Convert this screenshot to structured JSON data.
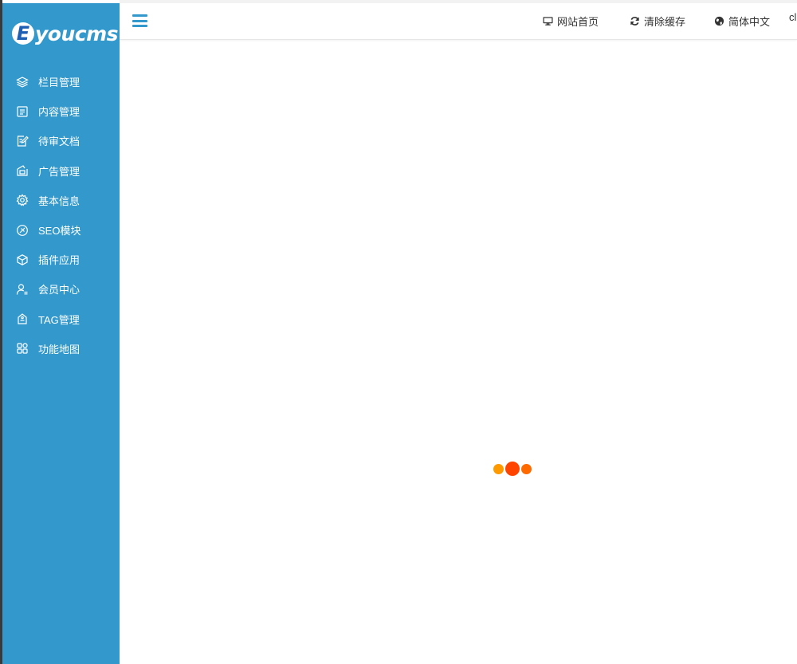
{
  "brand": {
    "logo_letter": "E",
    "logo_text": "youcms"
  },
  "sidebar": {
    "items": [
      {
        "label": "栏目管理",
        "icon": "layers-icon"
      },
      {
        "label": "内容管理",
        "icon": "document-icon"
      },
      {
        "label": "待审文档",
        "icon": "edit-document-icon"
      },
      {
        "label": "广告管理",
        "icon": "ad-icon"
      },
      {
        "label": "基本信息",
        "icon": "gear-icon"
      },
      {
        "label": "SEO模块",
        "icon": "seo-icon"
      },
      {
        "label": "插件应用",
        "icon": "cube-icon"
      },
      {
        "label": "会员中心",
        "icon": "user-icon"
      },
      {
        "label": "TAG管理",
        "icon": "tag-icon"
      },
      {
        "label": "功能地图",
        "icon": "grid-icon"
      }
    ]
  },
  "header": {
    "links": [
      {
        "label": "网站首页",
        "icon": "monitor-icon"
      },
      {
        "label": "清除缓存",
        "icon": "refresh-icon"
      },
      {
        "label": "简体中文",
        "icon": "globe-icon"
      }
    ],
    "user_text": "cl"
  },
  "colors": {
    "sidebar": "#3399cc",
    "loader_dots": [
      "#ff9900",
      "#ff4400",
      "#ff6a00"
    ]
  }
}
